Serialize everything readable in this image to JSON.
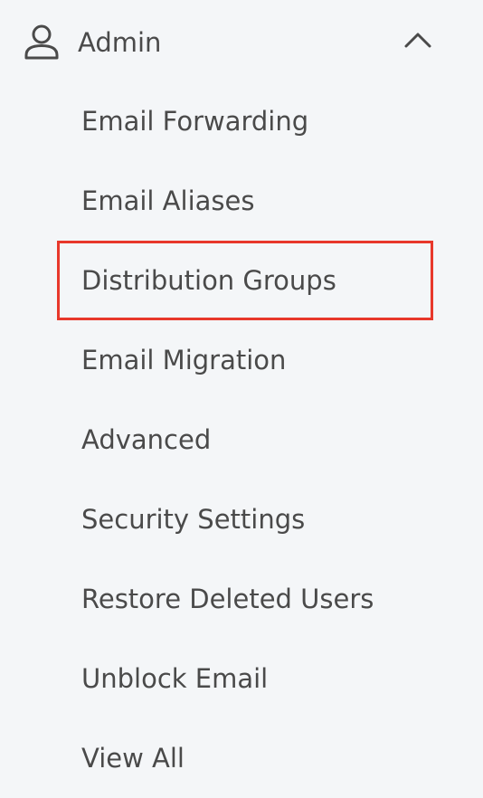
{
  "section": {
    "title": "Admin",
    "icon": "user-icon",
    "expanded_icon": "chevron-up-icon"
  },
  "items": [
    {
      "label": "Email Forwarding"
    },
    {
      "label": "Email Aliases"
    },
    {
      "label": "Distribution Groups",
      "highlighted": true
    },
    {
      "label": "Email Migration"
    },
    {
      "label": "Advanced"
    },
    {
      "label": "Security Settings"
    },
    {
      "label": "Restore Deleted Users"
    },
    {
      "label": "Unblock Email"
    },
    {
      "label": "View All"
    }
  ],
  "colors": {
    "background": "#f4f6f8",
    "text": "#4a4a4a",
    "highlight_border": "#e8382b"
  }
}
